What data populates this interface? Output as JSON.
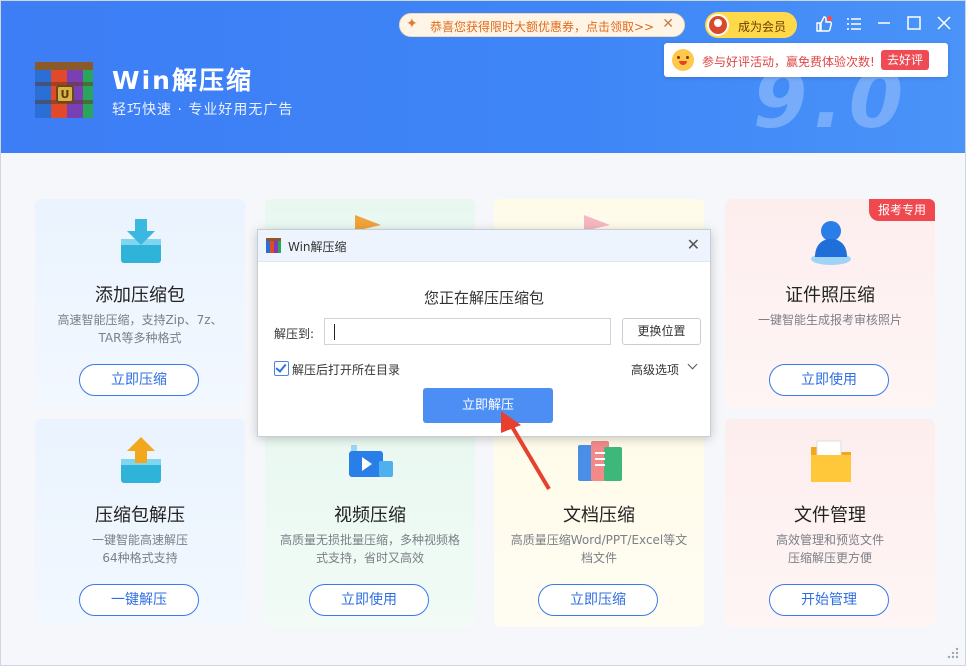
{
  "header": {
    "title": "Win解压缩",
    "subtitle": "轻巧快速 · 专业好用无广告",
    "version_art": "9.0",
    "promo_text": "恭喜您获得限时大额优惠券，点击领取>>",
    "member_label": "成为会员",
    "review_text": "参与好评活动，赢免费体验次数!",
    "review_button": "去好评"
  },
  "cards": [
    {
      "title": "添加压缩包",
      "desc": "高速智能压缩，支持Zip、7z、TAR等多种格式",
      "button": "立即压缩"
    },
    {
      "title": "",
      "desc": "",
      "button": ""
    },
    {
      "title": "",
      "desc": "",
      "button": ""
    },
    {
      "title": "证件照压缩",
      "desc": "一键智能生成报考审核照片",
      "button": "立即使用",
      "badge": "报考专用"
    },
    {
      "title": "压缩包解压",
      "desc": "一键智能高速解压\n64种格式支持",
      "button": "一键解压"
    },
    {
      "title": "视频压缩",
      "desc": "高质量无损批量压缩，多种视频格式支持，省时又高效",
      "button": "立即使用"
    },
    {
      "title": "文档压缩",
      "desc": "高质量压缩Word/PPT/Excel等文档文件",
      "button": "立即压缩"
    },
    {
      "title": "文件管理",
      "desc": "高效管理和预览文件\n压缩解压更方便",
      "button": "开始管理"
    }
  ],
  "dialog": {
    "title": "Win解压缩",
    "heading": "您正在解压压缩包",
    "extract_label": "解压到:",
    "extract_value": "",
    "change_button": "更换位置",
    "open_after_label": "解压后打开所在目录",
    "open_after_checked": true,
    "advanced_label": "高级选项",
    "extract_button": "立即解压"
  },
  "colors": {
    "header_blue": "#3e86f7",
    "accent": "#2f6fe0",
    "badge_red": "#f0484f",
    "member_yellow": "#ffd94a"
  }
}
